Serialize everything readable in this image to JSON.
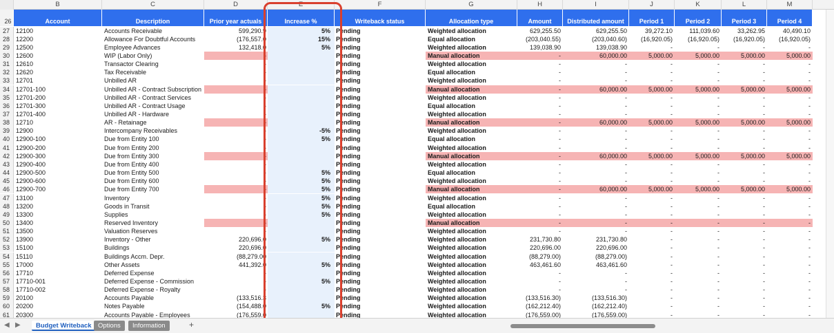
{
  "column_letters": [
    "B",
    "C",
    "D",
    "E",
    "F",
    "G",
    "H",
    "I",
    "J",
    "K",
    "L",
    "M"
  ],
  "header_row": {
    "row_number": "26",
    "labels": [
      "Account",
      "Description",
      "Prior year actuals",
      "Increase %",
      "Writeback status",
      "Allocation type",
      "Amount",
      "Distributed amount",
      "Period 1",
      "Period 2",
      "Period 3",
      "Period 4"
    ]
  },
  "rows": [
    {
      "n": "27",
      "account": "12100",
      "desc": "Accounts Receivable",
      "prior": "599,290.9",
      "inc": "5%",
      "status": "Pending",
      "alloc": "Weighted allocation",
      "amount": "629,255.50",
      "dist": "629,255.50",
      "p1": "39,272.10",
      "p2": "111,039.60",
      "p3": "33,262.95",
      "p4": "40,490.10"
    },
    {
      "n": "28",
      "account": "12200",
      "desc": "Allowance For Doubtful Accounts",
      "prior": "(176,557.0",
      "inc": "15%",
      "status": "Pending",
      "alloc": "Equal allocation",
      "amount": "(203,040.55)",
      "dist": "(203,040.60)",
      "p1": "(16,920.05)",
      "p2": "(16,920.05)",
      "p3": "(16,920.05)",
      "p4": "(16,920.05)"
    },
    {
      "n": "29",
      "account": "12500",
      "desc": "Employee Advances",
      "prior": "132,418.0",
      "inc": "5%",
      "status": "Pending",
      "alloc": "Weighted allocation",
      "amount": "139,038.90",
      "dist": "139,038.90",
      "p1": "-",
      "p2": "-",
      "p3": "-",
      "p4": "-"
    },
    {
      "n": "30",
      "account": "12600",
      "desc": "WIP (Labor Only)",
      "prior": "-",
      "inc": "",
      "status": "Pending",
      "alloc": "Manual allocation",
      "amount": "-",
      "dist": "60,000.00",
      "p1": "5,000.00",
      "p2": "5,000.00",
      "p3": "5,000.00",
      "p4": "5,000.00",
      "manual": true
    },
    {
      "n": "31",
      "account": "12610",
      "desc": "Transactor Clearing",
      "prior": "-",
      "inc": "",
      "status": "Pending",
      "alloc": "Weighted allocation",
      "amount": "-",
      "dist": "-",
      "p1": "-",
      "p2": "-",
      "p3": "-",
      "p4": "-"
    },
    {
      "n": "32",
      "account": "12620",
      "desc": "Tax Receivable",
      "prior": "-",
      "inc": "",
      "status": "Pending",
      "alloc": "Equal allocation",
      "amount": "-",
      "dist": "-",
      "p1": "-",
      "p2": "-",
      "p3": "-",
      "p4": "-"
    },
    {
      "n": "33",
      "account": "12701",
      "desc": "Unbilled AR",
      "prior": "-",
      "inc": "",
      "status": "Pending",
      "alloc": "Weighted allocation",
      "amount": "-",
      "dist": "-",
      "p1": "-",
      "p2": "-",
      "p3": "-",
      "p4": "-"
    },
    {
      "n": "34",
      "account": "12701-100",
      "desc": "Unbilled AR - Contract Subscription",
      "prior": "-",
      "inc": "",
      "status": "Pending",
      "alloc": "Manual allocation",
      "amount": "-",
      "dist": "60,000.00",
      "p1": "5,000.00",
      "p2": "5,000.00",
      "p3": "5,000.00",
      "p4": "5,000.00",
      "manual": true
    },
    {
      "n": "35",
      "account": "12701-200",
      "desc": "Unbilled AR - Contract Services",
      "prior": "-",
      "inc": "",
      "status": "Pending",
      "alloc": "Weighted allocation",
      "amount": "-",
      "dist": "-",
      "p1": "-",
      "p2": "-",
      "p3": "-",
      "p4": "-"
    },
    {
      "n": "36",
      "account": "12701-300",
      "desc": "Unbilled AR - Contract Usage",
      "prior": "-",
      "inc": "",
      "status": "Pending",
      "alloc": "Equal allocation",
      "amount": "-",
      "dist": "-",
      "p1": "-",
      "p2": "-",
      "p3": "-",
      "p4": "-"
    },
    {
      "n": "37",
      "account": "12701-400",
      "desc": "Unbilled AR - Hardware",
      "prior": "-",
      "inc": "",
      "status": "Pending",
      "alloc": "Weighted allocation",
      "amount": "-",
      "dist": "-",
      "p1": "-",
      "p2": "-",
      "p3": "-",
      "p4": "-"
    },
    {
      "n": "38",
      "account": "12710",
      "desc": "AR - Retainage",
      "prior": "-",
      "inc": "",
      "status": "Pending",
      "alloc": "Manual allocation",
      "amount": "-",
      "dist": "60,000.00",
      "p1": "5,000.00",
      "p2": "5,000.00",
      "p3": "5,000.00",
      "p4": "5,000.00",
      "manual": true
    },
    {
      "n": "39",
      "account": "12900",
      "desc": "Intercompany Receivables",
      "prior": "-",
      "inc": "-5%",
      "status": "Pending",
      "alloc": "Weighted allocation",
      "amount": "-",
      "dist": "-",
      "p1": "-",
      "p2": "-",
      "p3": "-",
      "p4": "-"
    },
    {
      "n": "40",
      "account": "12900-100",
      "desc": "Due from Entity 100",
      "prior": "-",
      "inc": "5%",
      "status": "Pending",
      "alloc": "Equal allocation",
      "amount": "-",
      "dist": "-",
      "p1": "-",
      "p2": "-",
      "p3": "-",
      "p4": "-"
    },
    {
      "n": "41",
      "account": "12900-200",
      "desc": "Due from Entity 200",
      "prior": "-",
      "inc": "",
      "status": "Pending",
      "alloc": "Weighted allocation",
      "amount": "-",
      "dist": "-",
      "p1": "-",
      "p2": "-",
      "p3": "-",
      "p4": "-"
    },
    {
      "n": "42",
      "account": "12900-300",
      "desc": "Due from Entity 300",
      "prior": "-",
      "inc": "",
      "status": "Pending",
      "alloc": "Manual allocation",
      "amount": "-",
      "dist": "60,000.00",
      "p1": "5,000.00",
      "p2": "5,000.00",
      "p3": "5,000.00",
      "p4": "5,000.00",
      "manual": true
    },
    {
      "n": "43",
      "account": "12900-400",
      "desc": "Due from Entity 400",
      "prior": "-",
      "inc": "",
      "status": "Pending",
      "alloc": "Weighted allocation",
      "amount": "-",
      "dist": "-",
      "p1": "-",
      "p2": "-",
      "p3": "-",
      "p4": "-"
    },
    {
      "n": "44",
      "account": "12900-500",
      "desc": "Due from Entity 500",
      "prior": "-",
      "inc": "5%",
      "status": "Pending",
      "alloc": "Equal allocation",
      "amount": "-",
      "dist": "-",
      "p1": "-",
      "p2": "-",
      "p3": "-",
      "p4": "-"
    },
    {
      "n": "45",
      "account": "12900-600",
      "desc": "Due from Entity 600",
      "prior": "-",
      "inc": "5%",
      "status": "Pending",
      "alloc": "Weighted allocation",
      "amount": "-",
      "dist": "-",
      "p1": "-",
      "p2": "-",
      "p3": "-",
      "p4": "-"
    },
    {
      "n": "46",
      "account": "12900-700",
      "desc": "Due from Entity 700",
      "prior": "-",
      "inc": "5%",
      "status": "Pending",
      "alloc": "Manual allocation",
      "amount": "-",
      "dist": "60,000.00",
      "p1": "5,000.00",
      "p2": "5,000.00",
      "p3": "5,000.00",
      "p4": "5,000.00",
      "manual": true
    },
    {
      "n": "47",
      "account": "13100",
      "desc": "Inventory",
      "prior": "-",
      "inc": "5%",
      "status": "Pending",
      "alloc": "Weighted allocation",
      "amount": "-",
      "dist": "-",
      "p1": "-",
      "p2": "-",
      "p3": "-",
      "p4": "-"
    },
    {
      "n": "48",
      "account": "13200",
      "desc": "Goods in Transit",
      "prior": "-",
      "inc": "5%",
      "status": "Pending",
      "alloc": "Equal allocation",
      "amount": "-",
      "dist": "-",
      "p1": "-",
      "p2": "-",
      "p3": "-",
      "p4": "-"
    },
    {
      "n": "49",
      "account": "13300",
      "desc": "Supplies",
      "prior": "-",
      "inc": "5%",
      "status": "Pending",
      "alloc": "Weighted allocation",
      "amount": "-",
      "dist": "-",
      "p1": "-",
      "p2": "-",
      "p3": "-",
      "p4": "-"
    },
    {
      "n": "50",
      "account": "13400",
      "desc": "Reserved Inventory",
      "prior": "-",
      "inc": "",
      "status": "Pending",
      "alloc": "Manual allocation",
      "amount": "-",
      "dist": "-",
      "p1": "-",
      "p2": "-",
      "p3": "-",
      "p4": "-",
      "manual": true
    },
    {
      "n": "51",
      "account": "13500",
      "desc": "Valuation Reserves",
      "prior": "-",
      "inc": "",
      "status": "Pending",
      "alloc": "Weighted allocation",
      "amount": "-",
      "dist": "-",
      "p1": "-",
      "p2": "-",
      "p3": "-",
      "p4": "-"
    },
    {
      "n": "52",
      "account": "13900",
      "desc": "Inventory - Other",
      "prior": "220,696.0",
      "inc": "5%",
      "status": "Pending",
      "alloc": "Weighted allocation",
      "amount": "231,730.80",
      "dist": "231,730.80",
      "p1": "-",
      "p2": "-",
      "p3": "-",
      "p4": "-"
    },
    {
      "n": "53",
      "account": "15100",
      "desc": "Buildings",
      "prior": "220,696.0",
      "inc": "",
      "status": "Pending",
      "alloc": "Weighted allocation",
      "amount": "220,696.00",
      "dist": "220,696.00",
      "p1": "-",
      "p2": "-",
      "p3": "-",
      "p4": "-"
    },
    {
      "n": "54",
      "account": "15110",
      "desc": "Buildings Accm. Depr.",
      "prior": "(88,279.00",
      "inc": "",
      "status": "Pending",
      "alloc": "Weighted allocation",
      "amount": "(88,279.00)",
      "dist": "(88,279.00)",
      "p1": "-",
      "p2": "-",
      "p3": "-",
      "p4": "-"
    },
    {
      "n": "55",
      "account": "17000",
      "desc": "Other Assets",
      "prior": "441,392.0",
      "inc": "5%",
      "status": "Pending",
      "alloc": "Weighted allocation",
      "amount": "463,461.60",
      "dist": "463,461.60",
      "p1": "-",
      "p2": "-",
      "p3": "-",
      "p4": "-"
    },
    {
      "n": "56",
      "account": "17710",
      "desc": "Deferred Expense",
      "prior": "-",
      "inc": "",
      "status": "Pending",
      "alloc": "Weighted allocation",
      "amount": "-",
      "dist": "-",
      "p1": "-",
      "p2": "-",
      "p3": "-",
      "p4": "-"
    },
    {
      "n": "57",
      "account": "17710-001",
      "desc": "Deferred Expense - Commission",
      "prior": "-",
      "inc": "5%",
      "status": "Pending",
      "alloc": "Weighted allocation",
      "amount": "-",
      "dist": "-",
      "p1": "-",
      "p2": "-",
      "p3": "-",
      "p4": "-"
    },
    {
      "n": "58",
      "account": "17710-002",
      "desc": "Deferred Expense - Royalty",
      "prior": "-",
      "inc": "",
      "status": "Pending",
      "alloc": "Weighted allocation",
      "amount": "-",
      "dist": "-",
      "p1": "-",
      "p2": "-",
      "p3": "-",
      "p4": "-"
    },
    {
      "n": "59",
      "account": "20100",
      "desc": "Accounts Payable",
      "prior": "(133,516.3",
      "inc": "",
      "status": "Pending",
      "alloc": "Weighted allocation",
      "amount": "(133,516.30)",
      "dist": "(133,516.30)",
      "p1": "-",
      "p2": "-",
      "p3": "-",
      "p4": "-"
    },
    {
      "n": "60",
      "account": "20200",
      "desc": "Notes Payable",
      "prior": "(154,488.0",
      "inc": "5%",
      "status": "Pending",
      "alloc": "Weighted allocation",
      "amount": "(162,212.40)",
      "dist": "(162,212.40)",
      "p1": "-",
      "p2": "-",
      "p3": "-",
      "p4": "-"
    },
    {
      "n": "61",
      "account": "20300",
      "desc": "Accounts Payable - Employees",
      "prior": "(176,559.0",
      "inc": "",
      "status": "Pending",
      "alloc": "Weighted allocation",
      "amount": "(176,559.00)",
      "dist": "(176,559.00)",
      "p1": "-",
      "p2": "-",
      "p3": "-",
      "p4": "-"
    }
  ],
  "sheet_tabs": [
    "Budget Writeback",
    "Options",
    "Information"
  ],
  "add_sheet": "+",
  "nav_prev": "◀",
  "nav_next": "▶",
  "colors": {
    "header_blue": "#2f6fed",
    "manual_pink": "#f6b4b4",
    "increase_col_bg": "#e8f1fc",
    "highlight_red": "#d9402e",
    "active_tab": "#1f5fbf"
  }
}
